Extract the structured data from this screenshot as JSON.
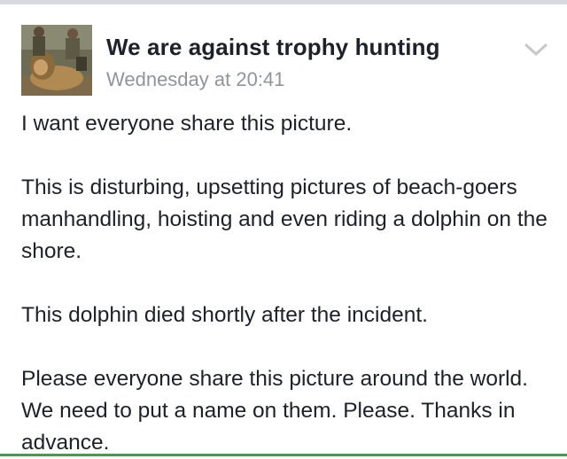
{
  "post": {
    "page_name": "We are against trophy hunting",
    "timestamp": "Wednesday at 20:41",
    "avatar_icon": "profile-photo",
    "menu_icon": "chevron-down-icon",
    "paragraphs": [
      "I want everyone share this picture.",
      "This is disturbing, upsetting pictures of beach-goers manhandling, hoisting and even riding a dolphin on the shore.",
      "This dolphin died shortly after the incident.",
      "Please everyone share this picture around the world. We need to put a name on them. Please. Thanks in advance."
    ]
  },
  "colors": {
    "name_text": "#1d2129",
    "meta_text": "#90949c",
    "accent_line": "#4c9a4c"
  }
}
